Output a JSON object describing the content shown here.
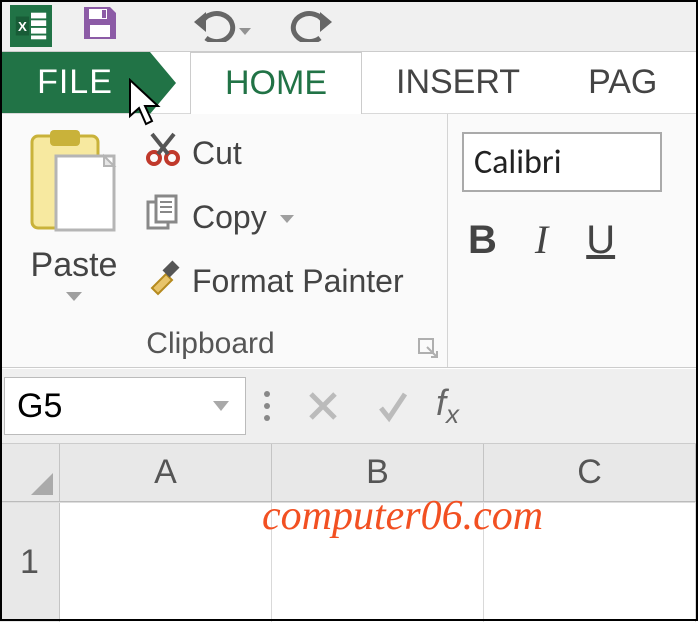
{
  "qat": {},
  "tabs": {
    "file": "FILE",
    "home": "HOME",
    "insert": "INSERT",
    "page": "PAG"
  },
  "clipboard": {
    "paste_label": "Paste",
    "cut_label": "Cut",
    "copy_label": "Copy",
    "format_painter_label": "Format Painter",
    "group_label": "Clipboard"
  },
  "font": {
    "font_name": "Calibri",
    "bold": "B",
    "italic": "I",
    "underline": "U"
  },
  "formula_bar": {
    "name_box_value": "G5",
    "fx_label": "fx"
  },
  "columns": [
    "A",
    "B",
    "C"
  ],
  "rows": [
    "1"
  ],
  "watermark": "computer06.com"
}
